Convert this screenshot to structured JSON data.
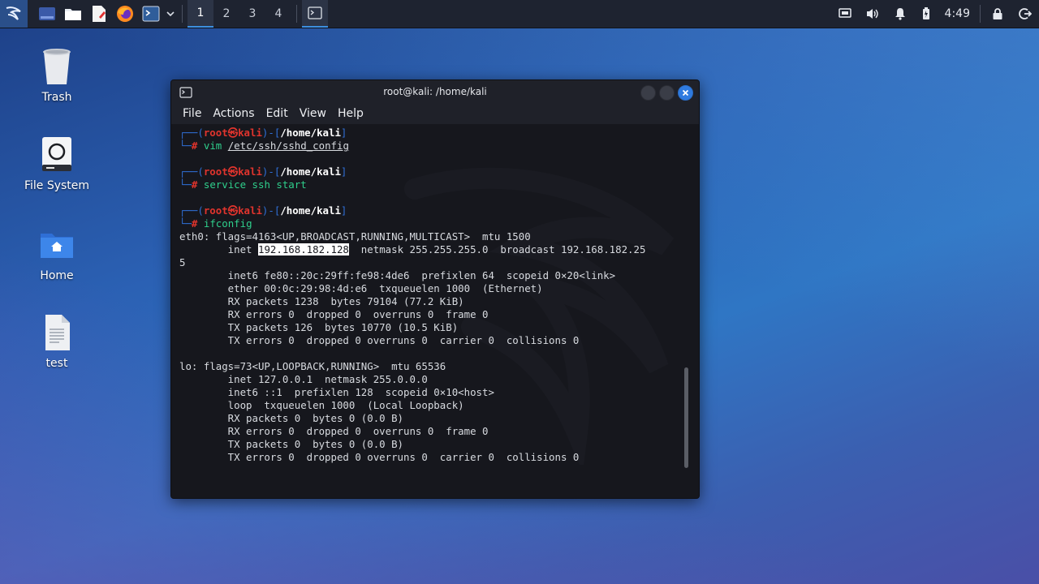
{
  "panel": {
    "workspaces": [
      "1",
      "2",
      "3",
      "4"
    ],
    "clock": "4:49",
    "icons": [
      "kali-menu-icon",
      "show-desktop-icon",
      "file-manager-icon",
      "text-editor-icon",
      "firefox-icon",
      "terminal-launcher-icon",
      "chevron-down-icon"
    ]
  },
  "desktop": {
    "icons": [
      {
        "label": "Trash",
        "icon": "trash-icon"
      },
      {
        "label": "File System",
        "icon": "drive-icon"
      },
      {
        "label": "Home",
        "icon": "home-folder-icon"
      },
      {
        "label": "test",
        "icon": "text-file-icon"
      }
    ]
  },
  "terminal": {
    "title": "root@kali: /home/kali",
    "menu": [
      "File",
      "Actions",
      "Edit",
      "View",
      "Help"
    ],
    "prompt": {
      "user": "root",
      "at": "㉿",
      "host": "kali",
      "path": "/home/kali",
      "hash": "#"
    },
    "commands": [
      "vim",
      "/etc/ssh/sshd_config",
      "service ssh start",
      "ifconfig"
    ],
    "output": {
      "eth0_flags": "eth0: flags=4163<UP,BROADCAST,RUNNING,MULTICAST>  mtu 1500",
      "eth0_inet_pre": "        inet ",
      "eth0_ip": "192.168.182.128",
      "eth0_inet_post": "  netmask 255.255.255.0  broadcast 192.168.182.25",
      "eth0_wrap": "5",
      "eth0_rest": "        inet6 fe80::20c:29ff:fe98:4de6  prefixlen 64  scopeid 0×20<link>\n        ether 00:0c:29:98:4d:e6  txqueuelen 1000  (Ethernet)\n        RX packets 1238  bytes 79104 (77.2 KiB)\n        RX errors 0  dropped 0  overruns 0  frame 0\n        TX packets 126  bytes 10770 (10.5 KiB)\n        TX errors 0  dropped 0 overruns 0  carrier 0  collisions 0",
      "lo_block": "lo: flags=73<UP,LOOPBACK,RUNNING>  mtu 65536\n        inet 127.0.0.1  netmask 255.0.0.0\n        inet6 ::1  prefixlen 128  scopeid 0×10<host>\n        loop  txqueuelen 1000  (Local Loopback)\n        RX packets 0  bytes 0 (0.0 B)\n        RX errors 0  dropped 0  overruns 0  frame 0\n        TX packets 0  bytes 0 (0.0 B)\n        TX errors 0  dropped 0 overruns 0  carrier 0  collisions 0"
    }
  }
}
